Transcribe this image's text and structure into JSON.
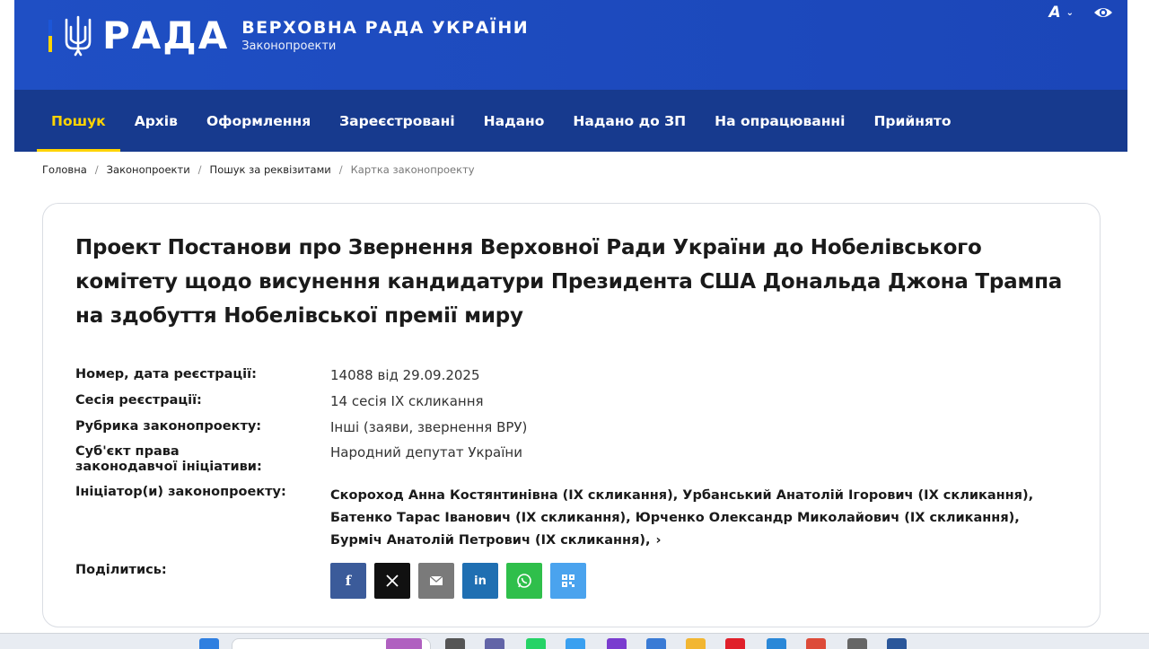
{
  "header": {
    "logo_word": "РАДА",
    "org_title": "ВЕРХОВНА РАДА УКРАЇНИ",
    "section": "Законопроекти",
    "font_toggle": "A",
    "colors": {
      "header_blue": "#1f4fc4",
      "nav_blue": "#173a8e",
      "accent": "#ffd400"
    }
  },
  "nav": {
    "items": [
      {
        "label": "Пошук",
        "active": true
      },
      {
        "label": "Архів"
      },
      {
        "label": "Оформлення"
      },
      {
        "label": "Зареєстровані"
      },
      {
        "label": "Надано"
      },
      {
        "label": "Надано до ЗП"
      },
      {
        "label": "На опрацюванні"
      },
      {
        "label": "Прийнято"
      }
    ]
  },
  "breadcrumb": [
    "Головна",
    "Законопроекти",
    "Пошук за реквізитами",
    "Картка законопроекту"
  ],
  "bill": {
    "title": "Проект Постанови про Звернення Верховної Ради України до Нобелівського комітету щодо висунення кандидатури Президента США Дональда Джона Трампа на здобуття Нобелівської премії миру",
    "fields": [
      {
        "label": "Номер, дата реєстрації:",
        "value": "14088 від 29.09.2025"
      },
      {
        "label": "Сесія реєстрації:",
        "value": "14 сесія IX скликання"
      },
      {
        "label": "Рубрика законопроекту:",
        "value": "Інші (заяви, звернення ВРУ)"
      },
      {
        "label": "Суб'єкт права законодавчої ініціативи:",
        "value": "Народний депутат України"
      }
    ],
    "initiators_label": "Ініціатор(и) законопроекту:",
    "initiators": "Скороход Анна Костянтинівна (IX скликання), Урбанський Анатолій Ігорович (IX скликання), Батенко Тарас Іванович (IX скликання), Юрченко Олександр Миколайович (IX скликання), Бурміч Анатолій Петрович (IX скликання),",
    "more_icon": "chevron-right-icon",
    "share_label": "Поділитись:",
    "share": [
      {
        "icon": "facebook-icon",
        "color": "#3b5b9a"
      },
      {
        "icon": "x-icon",
        "color": "#111111"
      },
      {
        "icon": "email-icon",
        "color": "#7a7a7a"
      },
      {
        "icon": "linkedin-icon",
        "color": "#1f6fb2"
      },
      {
        "icon": "whatsapp-icon",
        "color": "#2fbf4b"
      },
      {
        "icon": "qr-code-icon",
        "color": "#4aa3ee"
      }
    ]
  }
}
